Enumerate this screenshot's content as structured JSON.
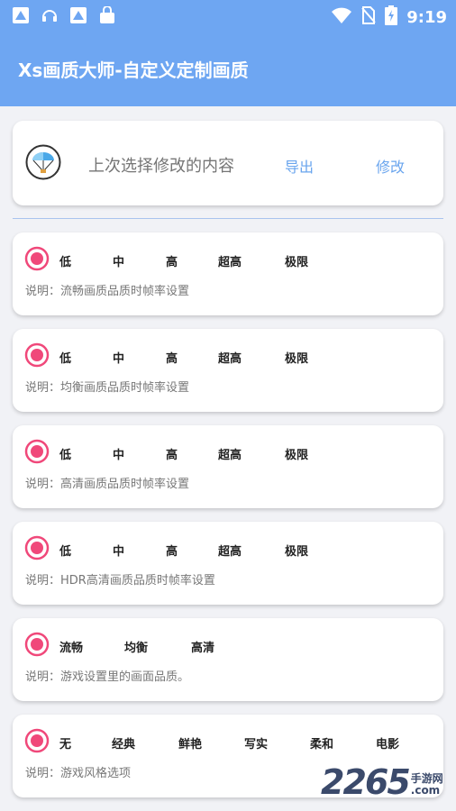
{
  "status_bar": {
    "icons": [
      "app-notification-icon",
      "headset-notification-icon",
      "app-notification-icon",
      "bag-notification-icon"
    ],
    "system_icons": [
      "wifi-icon",
      "no-sim-icon",
      "battery-charging-icon"
    ],
    "time": "9:19"
  },
  "app_bar": {
    "title": "Xs画质大师-自定义定制画质"
  },
  "last_card": {
    "label": "上次选择修改的内容",
    "export_label": "导出",
    "modify_label": "修改"
  },
  "settings": [
    {
      "options": [
        "低",
        "中",
        "高",
        "超高",
        "极限"
      ],
      "description": "说明：流畅画质品质时帧率设置"
    },
    {
      "options": [
        "低",
        "中",
        "高",
        "超高",
        "极限"
      ],
      "description": "说明：均衡画质品质时帧率设置"
    },
    {
      "options": [
        "低",
        "中",
        "高",
        "超高",
        "极限"
      ],
      "description": "说明：高清画质品质时帧率设置"
    },
    {
      "options": [
        "低",
        "中",
        "高",
        "超高",
        "极限"
      ],
      "description": "说明：HDR高清画质品质时帧率设置"
    },
    {
      "options": [
        "流畅",
        "均衡",
        "高清"
      ],
      "description": "说明：游戏设置里的画面品质。"
    },
    {
      "options": [
        "无",
        "经典",
        "鲜艳",
        "写实",
        "柔和",
        "电影"
      ],
      "description": "说明：游戏风格选项"
    }
  ],
  "watermark": {
    "number": "2265",
    "site": "手游网",
    "domain": ".com"
  },
  "colors": {
    "primary": "#6ea6f2",
    "radio": "#f0487a",
    "link": "#6aa5ee",
    "background": "#f1f2f6"
  }
}
